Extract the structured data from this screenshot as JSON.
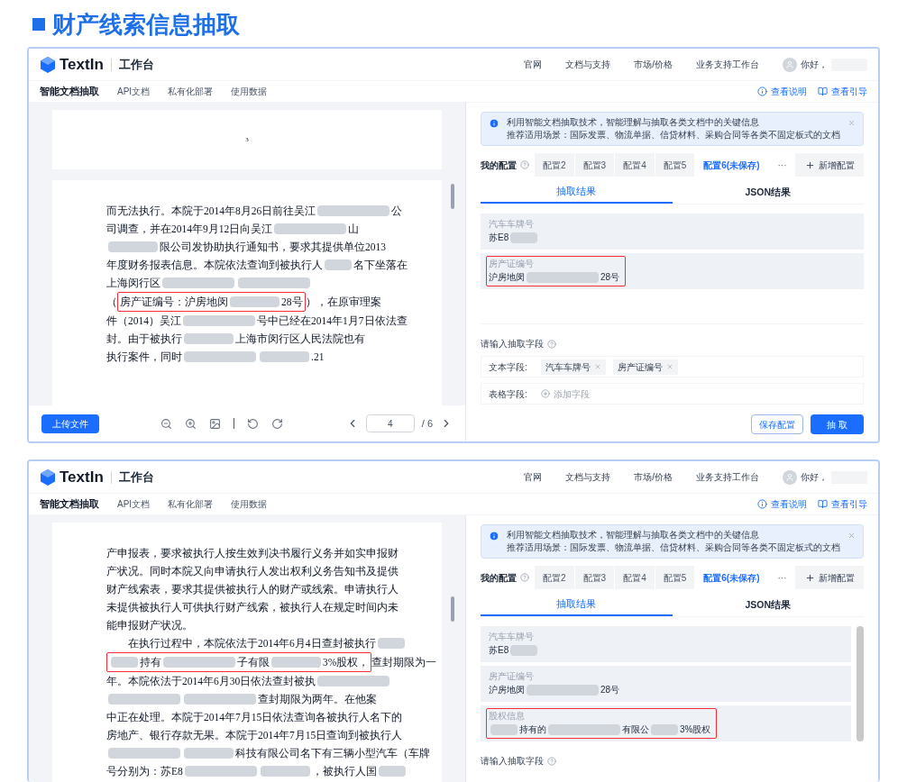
{
  "title": "财产线索信息抽取",
  "panels": [
    {
      "header": {
        "brand": "TextIn",
        "app": "工作台",
        "links": [
          "官网",
          "文档与支持",
          "市场/价格",
          "业务支持工作台"
        ],
        "greeting": "你好，"
      },
      "subnav": {
        "tabs": [
          {
            "label": "智能文档抽取",
            "selected": true
          },
          {
            "label": "API文档",
            "selected": false
          },
          {
            "label": "私有化部署",
            "selected": false
          },
          {
            "label": "使用数据",
            "selected": false
          }
        ],
        "help": "查看说明",
        "guide": "查看引导"
      },
      "document": {
        "pages": [
          {
            "page_number": "3"
          },
          {
            "lines": [
              [
                {
                  "kind": "text",
                  "text": "而无法执行。本院于2014年8月26日前往吴江"
                },
                {
                  "kind": "blur-l"
                },
                {
                  "kind": "text",
                  "text": "公"
                }
              ],
              [
                {
                  "kind": "text",
                  "text": "司调查，并在2014年9月12日向吴江"
                },
                {
                  "kind": "blur-l"
                },
                {
                  "kind": "text",
                  "text": "山"
                }
              ],
              [
                {
                  "kind": "blur-m"
                },
                {
                  "kind": "text",
                  "text": "限公司发协助执行通知书，要求其提供单位2013"
                }
              ],
              [
                {
                  "kind": "text",
                  "text": "年度财务报表信息。本院依法查询到被执行人"
                },
                {
                  "kind": "blur-s"
                },
                {
                  "kind": "text",
                  "text": "名下坐落在"
                }
              ],
              [
                {
                  "kind": "text",
                  "text": "上海闵行区"
                },
                {
                  "kind": "blur-l"
                },
                {
                  "kind": "blur-l"
                }
              ],
              [
                {
                  "kind": "text",
                  "text": "（"
                },
                {
                  "kind": "box",
                  "children": [
                    {
                      "kind": "text",
                      "text": "房产证编号：沪房地闵"
                    },
                    {
                      "kind": "blur-m"
                    },
                    {
                      "kind": "text",
                      "text": "28号"
                    }
                  ]
                },
                {
                  "kind": "text",
                  "text": "），在原审理案"
                }
              ],
              [
                {
                  "kind": "text",
                  "text": "件（2014）吴江"
                },
                {
                  "kind": "blur-l"
                },
                {
                  "kind": "text",
                  "text": "号中已经在2014年1月7日依法查"
                }
              ],
              [
                {
                  "kind": "text",
                  "text": "封。由于被执行"
                },
                {
                  "kind": "blur-m"
                },
                {
                  "kind": "text",
                  "text": "上海市闵行区人民法院也有"
                }
              ],
              [
                {
                  "kind": "text",
                  "text": "执行案件，同时"
                },
                {
                  "kind": "blur-l"
                },
                {
                  "kind": "blur-m"
                },
                {
                  "kind": "text",
                  "text": ".21"
                }
              ]
            ]
          }
        ]
      },
      "pager": {
        "upload": "上传文件",
        "page": "4",
        "total": "/ 6"
      },
      "notice": [
        "利用智能文档抽取技术，智能理解与抽取各类文档中的关键信息",
        "推荐适用场景：国际发票、物流单据、信贷材料、采购合同等各类不固定板式的文档"
      ],
      "configs": {
        "label": "我的配置",
        "tabs": [
          {
            "label": "配置2",
            "selected": false
          },
          {
            "label": "配置3",
            "selected": false
          },
          {
            "label": "配置4",
            "selected": false
          },
          {
            "label": "配置5",
            "selected": false
          },
          {
            "label": "配置6(未保存)",
            "selected": true
          }
        ],
        "more": "···",
        "add": "新增配置"
      },
      "result_tabs": [
        {
          "label": "抽取结果",
          "selected": true
        },
        {
          "label": "JSON结果",
          "selected": false
        }
      ],
      "fields": [
        {
          "label": "汽车车牌号",
          "value": [
            {
              "kind": "text",
              "text": "苏E8"
            },
            {
              "kind": "blur-s"
            }
          ],
          "highlighted": false
        },
        {
          "label": "房产证编号",
          "value": [
            {
              "kind": "text",
              "text": "沪房地闵"
            },
            {
              "kind": "blur-l"
            },
            {
              "kind": "text",
              "text": "28号"
            }
          ],
          "highlighted": true
        }
      ],
      "extract_input": {
        "label": "请输入抽取字段",
        "rows": [
          {
            "kind": "tags",
            "label": "文本字段:",
            "tags": [
              "汽车车牌号",
              "房产证编号"
            ]
          },
          {
            "kind": "add",
            "label": "表格字段:",
            "placeholder": "添加字段"
          }
        ]
      },
      "actions": {
        "save": "保存配置",
        "run": "抽 取"
      }
    },
    {
      "header": {
        "brand": "TextIn",
        "app": "工作台",
        "links": [
          "官网",
          "文档与支持",
          "市场/价格",
          "业务支持工作台"
        ],
        "greeting": "你好，"
      },
      "subnav": {
        "tabs": [
          {
            "label": "智能文档抽取",
            "selected": true
          },
          {
            "label": "API文档",
            "selected": false
          },
          {
            "label": "私有化部署",
            "selected": false
          },
          {
            "label": "使用数据",
            "selected": false
          }
        ],
        "help": "查看说明",
        "guide": "查看引导"
      },
      "document": {
        "pages": [
          {
            "lines": [
              [
                {
                  "kind": "text",
                  "text": "产申报表，要求被执行人按生效判决书履行义务并如实申报财"
                }
              ],
              [
                {
                  "kind": "text",
                  "text": "产状况。同时本院又向申请执行人发出权利义务告知书及提供"
                }
              ],
              [
                {
                  "kind": "text",
                  "text": "财产线索表，要求其提供被执行人的财产或线索。申请执行人"
                }
              ],
              [
                {
                  "kind": "text",
                  "text": "未提供被执行人可供执行财产线索，被执行人在规定时间内未"
                }
              ],
              [
                {
                  "kind": "text",
                  "text": "能申报财产状况。"
                }
              ],
              [
                {
                  "kind": "text",
                  "text": "　　在执行过程中，本院依法于2014年6月4日查封被执行"
                },
                {
                  "kind": "blur-s"
                }
              ],
              [
                {
                  "kind": "box",
                  "children": [
                    {
                      "kind": "blur-s"
                    },
                    {
                      "kind": "text",
                      "text": "持有"
                    },
                    {
                      "kind": "blur-l"
                    },
                    {
                      "kind": "text",
                      "text": "子有限"
                    },
                    {
                      "kind": "blur-m"
                    },
                    {
                      "kind": "text",
                      "text": "3%股权，"
                    }
                  ]
                },
                {
                  "kind": "text",
                  "text": "查封期限为一"
                }
              ],
              [
                {
                  "kind": "text",
                  "text": "年。本院依法于2014年6月30日依法查封被执"
                },
                {
                  "kind": "blur-l"
                }
              ],
              [
                {
                  "kind": "blur-l"
                },
                {
                  "kind": "blur-l"
                },
                {
                  "kind": "text",
                  "text": "查封期限为两年。在他案"
                }
              ],
              [
                {
                  "kind": "text",
                  "text": "中正在处理。本院于2014年7月15日依法查询各被执行人名下的"
                }
              ],
              [
                {
                  "kind": "text",
                  "text": "房地产、银行存款无果。本院于2014年7月15日查询到被执行人"
                }
              ],
              [
                {
                  "kind": "blur-l"
                },
                {
                  "kind": "blur-m"
                },
                {
                  "kind": "text",
                  "text": "科技有限公司名下有三辆小型汽车（车牌"
                }
              ],
              [
                {
                  "kind": "text",
                  "text": "号分别为：苏E8"
                },
                {
                  "kind": "blur-l"
                },
                {
                  "kind": "blur-m"
                },
                {
                  "kind": "text",
                  "text": "，被执行人国"
                },
                {
                  "kind": "blur-s"
                }
              ]
            ]
          }
        ]
      },
      "notice": [
        "利用智能文档抽取技术，智能理解与抽取各类文档中的关键信息",
        "推荐适用场景：国际发票、物流单据、信贷材料、采购合同等各类不固定板式的文档"
      ],
      "configs": {
        "label": "我的配置",
        "tabs": [
          {
            "label": "配置2",
            "selected": false
          },
          {
            "label": "配置3",
            "selected": false
          },
          {
            "label": "配置4",
            "selected": false
          },
          {
            "label": "配置5",
            "selected": false
          },
          {
            "label": "配置6(未保存)",
            "selected": true
          }
        ],
        "more": "···",
        "add": "新增配置"
      },
      "result_tabs": [
        {
          "label": "抽取结果",
          "selected": true
        },
        {
          "label": "JSON结果",
          "selected": false
        }
      ],
      "fields": [
        {
          "label": "汽车车牌号",
          "value": [
            {
              "kind": "text",
              "text": "苏E8"
            },
            {
              "kind": "blur-s"
            }
          ],
          "highlighted": false
        },
        {
          "label": "房产证编号",
          "value": [
            {
              "kind": "text",
              "text": "沪房地闵"
            },
            {
              "kind": "blur-l"
            },
            {
              "kind": "text",
              "text": "28号"
            }
          ],
          "highlighted": false
        },
        {
          "label": "股权信息",
          "value": [
            {
              "kind": "blur-s"
            },
            {
              "kind": "text",
              "text": "持有的"
            },
            {
              "kind": "blur-l"
            },
            {
              "kind": "text",
              "text": "有限公"
            },
            {
              "kind": "blur-s"
            },
            {
              "kind": "text",
              "text": "3%股权"
            }
          ],
          "highlighted": true
        }
      ],
      "extract_input": {
        "label": "请输入抽取字段"
      }
    }
  ]
}
